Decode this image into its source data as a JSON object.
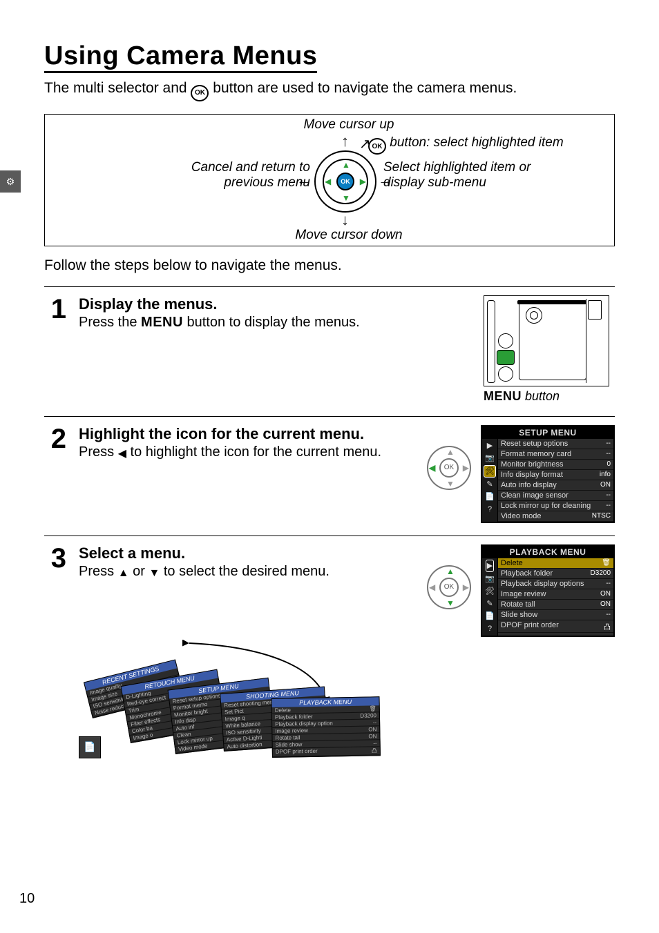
{
  "side_tab_glyph": "⚙",
  "title": "Using Camera Menus",
  "intro_pre": "The multi selector and ",
  "intro_post": " button are used to navigate the camera menus.",
  "ok_glyph": "OK",
  "diagram": {
    "move_up": "Move cursor up",
    "move_down": "Move cursor down",
    "cancel_line1": "Cancel and return to",
    "cancel_line2": "previous menu",
    "ok_desc": " button: select highlighted item",
    "select_line1": "Select highlighted item or",
    "select_line2": "display sub-menu"
  },
  "follow_text": "Follow the steps below to navigate the menus.",
  "steps": [
    {
      "num": "1",
      "title": "Display the menus.",
      "desc_pre": "Press the ",
      "desc_menu": "MENU",
      "desc_post": " button to display the menus.",
      "caption_menu": "MENU",
      "caption_post": " button"
    },
    {
      "num": "2",
      "title": "Highlight the icon for the current menu.",
      "desc_pre": "Press ",
      "desc_arrow": "◀",
      "desc_post": " to highlight the icon for the current menu."
    },
    {
      "num": "3",
      "title": "Select a menu.",
      "desc_pre": "Press ",
      "desc_up": "▲",
      "desc_mid": " or ",
      "desc_down": "▼",
      "desc_post": " to select the desired menu."
    }
  ],
  "setup_menu": {
    "header": "SETUP MENU",
    "icons": [
      "▶",
      "📷",
      "🛠",
      "✎",
      "📄",
      "?"
    ],
    "highlight_icon_index": 2,
    "rows": [
      {
        "label": "Reset setup options",
        "val": "--"
      },
      {
        "label": "Format memory card",
        "val": "--"
      },
      {
        "label": "Monitor brightness",
        "val": "0"
      },
      {
        "label": "Info display format",
        "val": "info"
      },
      {
        "label": "Auto info display",
        "val": "ON"
      },
      {
        "label": "Clean image sensor",
        "val": "--"
      },
      {
        "label": "Lock mirror up for cleaning",
        "val": "--"
      },
      {
        "label": "Video mode",
        "val": "NTSC"
      }
    ]
  },
  "playback_menu": {
    "header": "PLAYBACK MENU",
    "icons": [
      "▶",
      "📷",
      "🛠",
      "✎",
      "📄",
      "?"
    ],
    "highlight_icon_index": 0,
    "rows": [
      {
        "label": "Delete",
        "val": "🗑",
        "sel": true
      },
      {
        "label": "Playback folder",
        "val": "D3200"
      },
      {
        "label": "Playback display options",
        "val": "--"
      },
      {
        "label": "Image review",
        "val": "ON"
      },
      {
        "label": "Rotate tall",
        "val": "ON"
      },
      {
        "label": "Slide show",
        "val": "--"
      },
      {
        "label": "DPOF print order",
        "val": "凸"
      }
    ]
  },
  "fanned_menus": [
    {
      "title": "RECENT SETTINGS",
      "rows": [
        "Image quality",
        "Image size",
        "ISO sensitivity",
        "Noise reduction"
      ]
    },
    {
      "title": "RETOUCH MENU",
      "rows": [
        "D-Lighting",
        "Red-eye correct",
        "Trim",
        "Monochrome",
        "Filter effects",
        "Color ba",
        "Image o"
      ]
    },
    {
      "title": "SETUP MENU",
      "rows": [
        "Reset setup options",
        "Format memo",
        "Monitor bright",
        "Info disp",
        "Auto inf",
        "Clean",
        "Lock mirror up",
        "Video mode"
      ]
    },
    {
      "title": "SHOOTING MENU",
      "rows": [
        "Reset shooting menu",
        "Set Pict",
        "Image q",
        "White balance",
        "ISO sensitivity",
        "Active D-Lighti",
        "Auto distortion"
      ]
    },
    {
      "title": "PLAYBACK MENU",
      "rows": [
        "Delete",
        "Playback folder",
        "Playback display option",
        "Image review",
        "Rotate tall",
        "Slide show",
        "DPOF print order"
      ],
      "vals": [
        "🗑",
        "D3200",
        "--",
        "ON",
        "ON",
        "--",
        "凸"
      ]
    }
  ],
  "page_number": "10"
}
